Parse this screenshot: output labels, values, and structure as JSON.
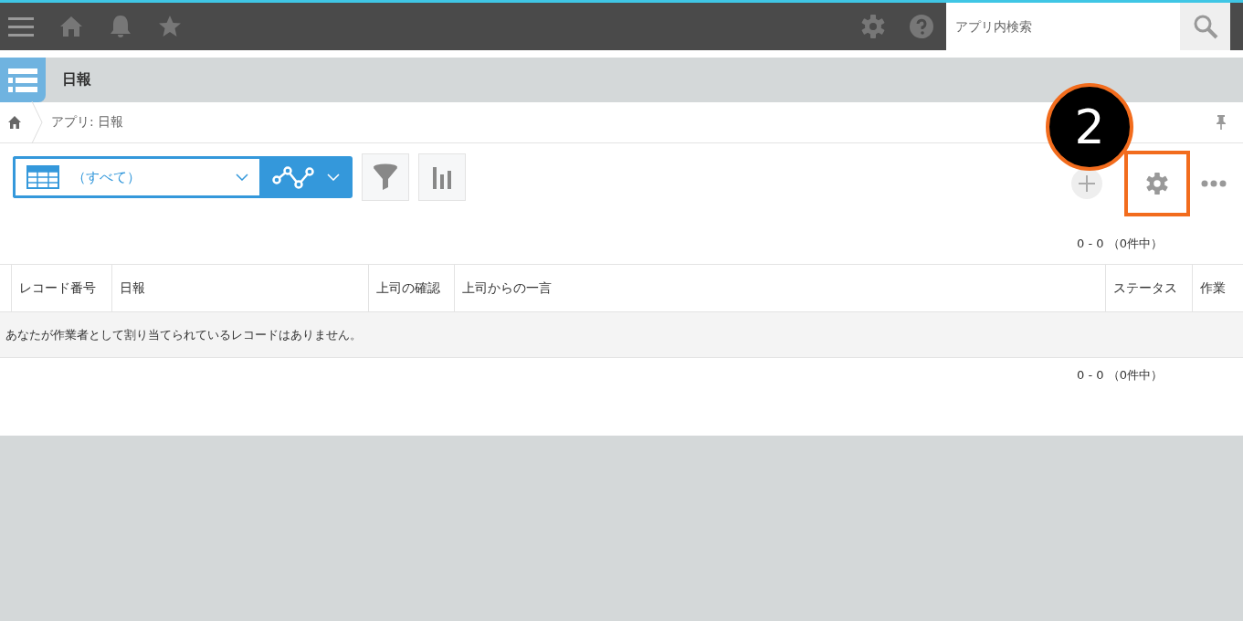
{
  "header": {
    "search": {
      "placeholder": "アプリ内検索"
    }
  },
  "app": {
    "title": "日報"
  },
  "breadcrumb": {
    "label": "アプリ: 日報"
  },
  "view_select": {
    "value": "（すべて）"
  },
  "annotation": {
    "number": "2"
  },
  "count_top": "0 - 0 （0件中）",
  "table": {
    "columns": [
      "レコード番号",
      "日報",
      "上司の確認",
      "上司からの一言",
      "ステータス",
      "作業"
    ],
    "empty_message": "あなたが作業者として割り当てられているレコードはありません。"
  },
  "count_bottom": "0 - 0 （0件中）"
}
